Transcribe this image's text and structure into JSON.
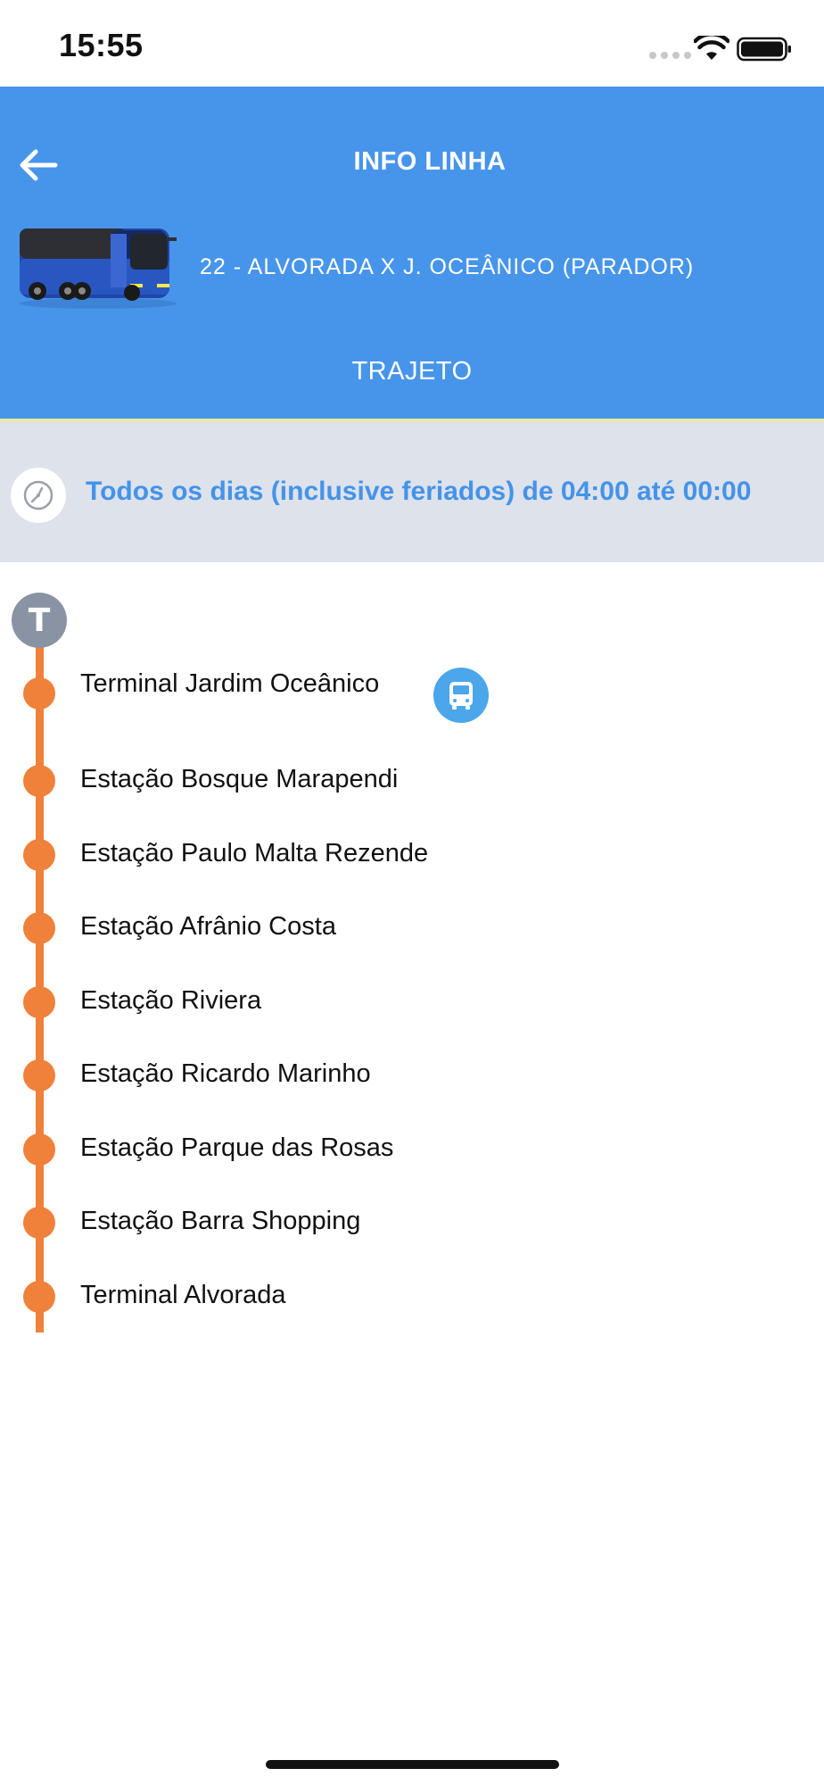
{
  "status_bar": {
    "time": "15:55"
  },
  "header": {
    "title": "INFO LINHA",
    "line_name": "22 - ALVORADA X J. OCEÂNICO (PARADOR)",
    "tab_label": "TRAJETO",
    "background_color": "#4795ea"
  },
  "schedule": {
    "text": "Todos os dias (inclusive feriados) de 04:00 até 00:00",
    "icon": "clock-icon"
  },
  "route": {
    "terminal_badge": "T",
    "accent_color": "#f0813a",
    "stops": [
      {
        "label": "Terminal Jardim Oceânico",
        "has_bus": true
      },
      {
        "label": "Estação Bosque Marapendi"
      },
      {
        "label": "Estação Paulo Malta Rezende"
      },
      {
        "label": "Estação Afrânio Costa"
      },
      {
        "label": "Estação Riviera"
      },
      {
        "label": "Estação Ricardo Marinho"
      },
      {
        "label": "Estação Parque das Rosas"
      },
      {
        "label": "Estação Barra Shopping"
      },
      {
        "label": "Terminal Alvorada"
      }
    ]
  }
}
